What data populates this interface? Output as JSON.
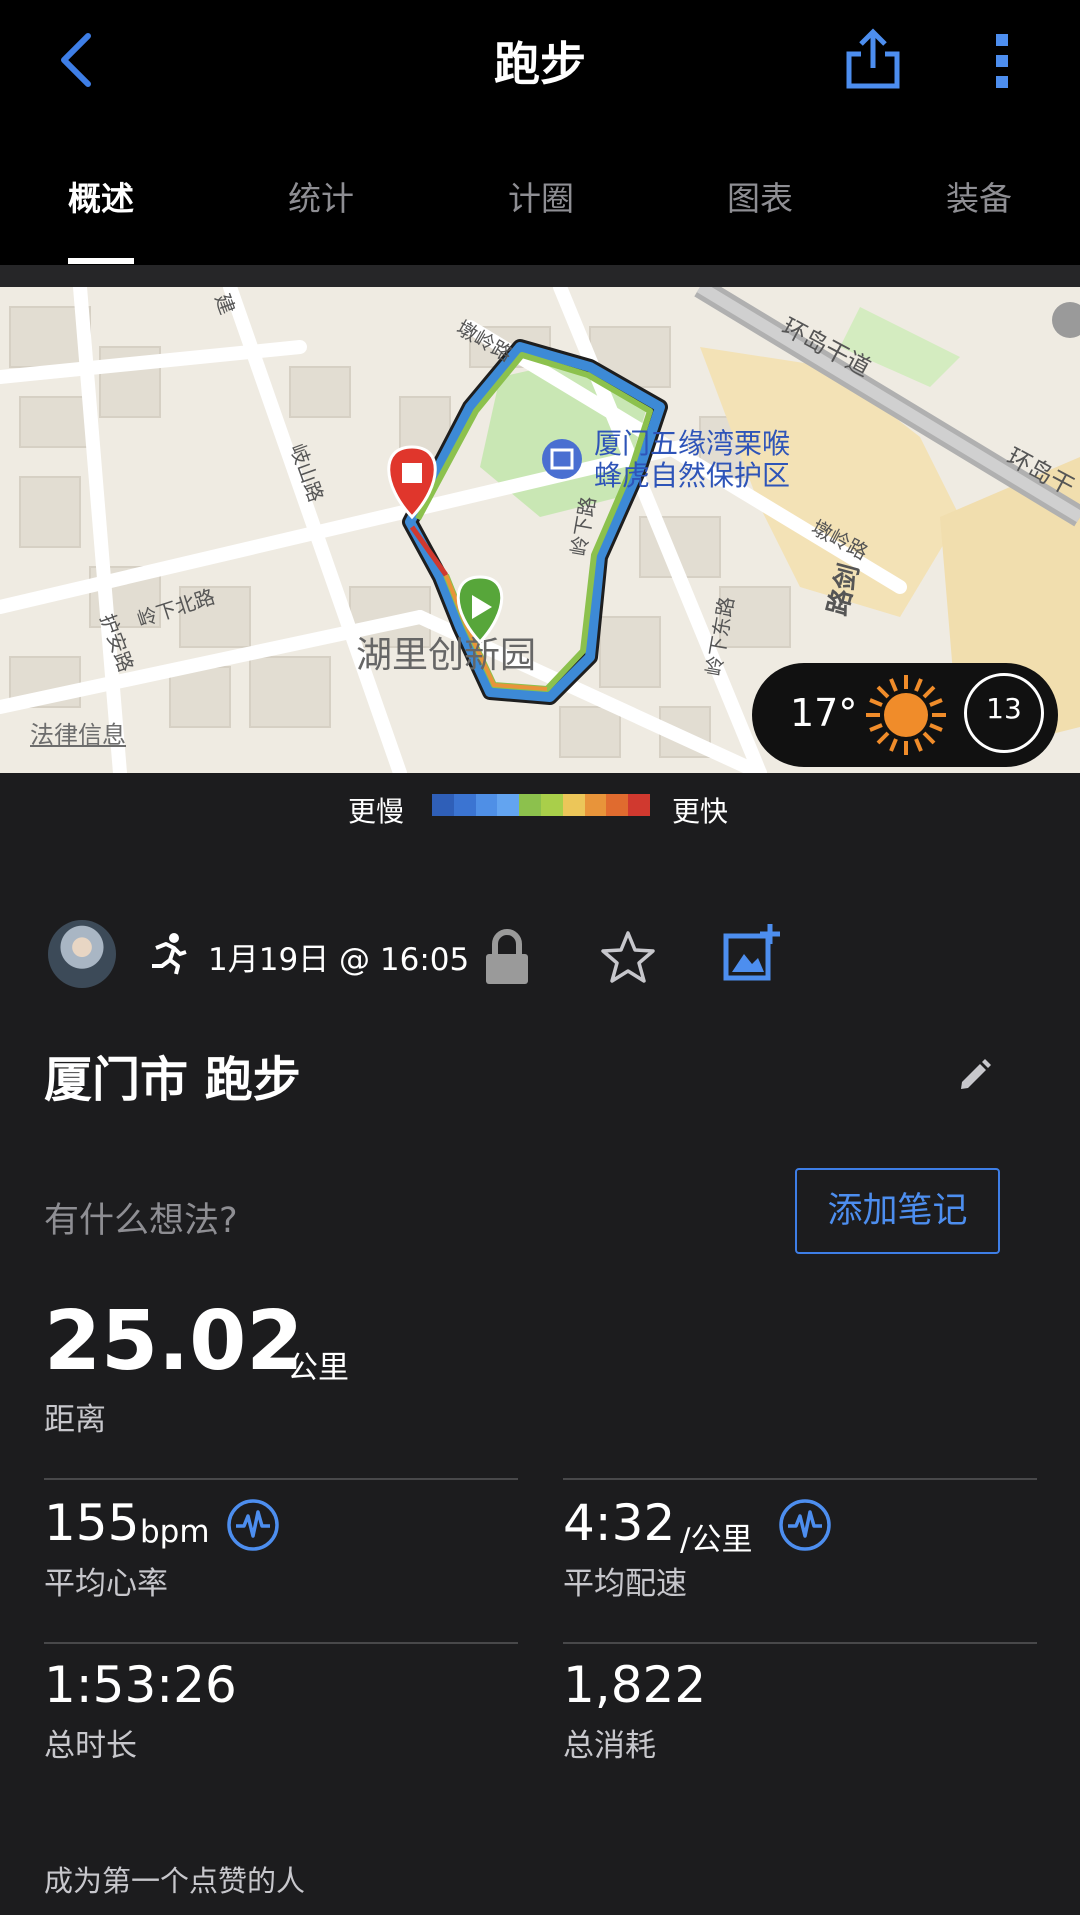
{
  "header": {
    "title": "跑步",
    "tabs": [
      {
        "label": "概述",
        "active": true
      },
      {
        "label": "统计",
        "active": false
      },
      {
        "label": "计圈",
        "active": false
      },
      {
        "label": "图表",
        "active": false
      },
      {
        "label": "装备",
        "active": false
      }
    ],
    "icons": [
      "chevron-left-icon",
      "share-icon",
      "more-vertical-icon"
    ]
  },
  "map": {
    "labels": {
      "reserve_line1": "厦门五缘湾栗喉",
      "reserve_line2": "蜂虎自然保护区",
      "park": "湖里创新园",
      "road_dunling_1": "墩岭路",
      "road_dunling_2": "墩岭路",
      "road_huandao": "环岛干道",
      "road_huandao_2": "环岛干",
      "road_qishan": "岐山路",
      "road_lingxiabei": "岭下北路",
      "road_lingxia": "岭下路",
      "road_lingxiadong": "岭下东路",
      "road_hu_an": "护安路",
      "road_jian": "建",
      "road_jian_2": "路剑"
    },
    "legal": "法律信息",
    "weather": {
      "temperature": "17°",
      "wind": "13"
    }
  },
  "pace_legend": {
    "slower": "更慢",
    "faster": "更快",
    "colors": [
      "#2f5fb8",
      "#3b74d2",
      "#4f8fe6",
      "#63a4f0",
      "#8cc14d",
      "#a9cf4a",
      "#ecc659",
      "#e8943a",
      "#e06b2f",
      "#d0392f"
    ]
  },
  "activity": {
    "datetime": "1月19日 @ 16:05",
    "name": "厦门市 跑步",
    "note_prompt": "有什么想法?",
    "add_note_label": "添加笔记",
    "accent_color": "#4d8eef"
  },
  "stats": {
    "distance": {
      "value": "25.02",
      "unit": "公里",
      "label": "距离"
    },
    "avg_hr": {
      "value": "155",
      "unit": "bpm",
      "label": "平均心率"
    },
    "avg_pace": {
      "value": "4:32",
      "unit": "/公里",
      "label": "平均配速"
    },
    "duration": {
      "value": "1:53:26",
      "label": "总时长"
    },
    "calories": {
      "value": "1,822",
      "label": "总消耗"
    }
  },
  "kudos_prompt": "成为第一个点赞的人"
}
